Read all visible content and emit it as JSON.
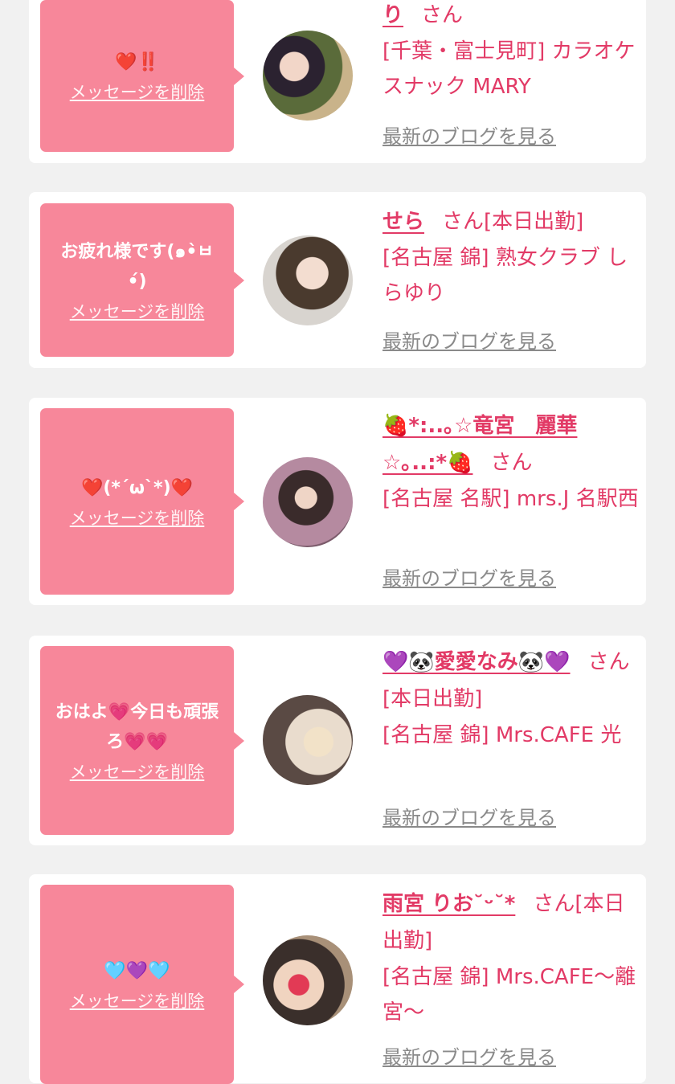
{
  "delete_label": "メッセージを削除",
  "blog_label": "最新のブログを見る",
  "san_suffix": "さん",
  "colors": {
    "background": "#f1f1f1",
    "card": "#ffffff",
    "bubble": "#f7879a",
    "accent": "#e23a66",
    "link_gray": "#8a8a8a"
  },
  "items": [
    {
      "message": "❤️‼️",
      "name": "り",
      "status": "",
      "shop": "[千葉・富士見町] カラオケスナック MARY",
      "avatar_icon": "avatar-photo"
    },
    {
      "message": "お疲れ様です(๑•̀ㅂ•́)",
      "name": "せら",
      "status": "[本日出勤]",
      "shop": "[名古屋 錦] 熟女クラブ しらゆり",
      "avatar_icon": "avatar-photo"
    },
    {
      "message": "❤️(*´ω`*)❤️",
      "name": "🍓*:..｡☆竜宮　麗華☆｡..:*🍓",
      "status": "",
      "shop": "[名古屋 名駅] mrs.J 名駅西",
      "avatar_icon": "avatar-photo"
    },
    {
      "message": "おはよ💗今日も頑張ろ💗💗",
      "name": "💜🐼愛愛なみ🐼💜",
      "status": "[本日出勤]",
      "shop": "[名古屋 錦] Mrs.CAFE 光",
      "avatar_icon": "avatar-photo"
    },
    {
      "message": "🩵💜🩵",
      "name": "雨宮 りお˘ᵕ˘*",
      "status": "[本日出勤]",
      "shop": "[名古屋 錦] Mrs.CAFE〜離宮〜",
      "avatar_icon": "avatar-photo"
    }
  ]
}
